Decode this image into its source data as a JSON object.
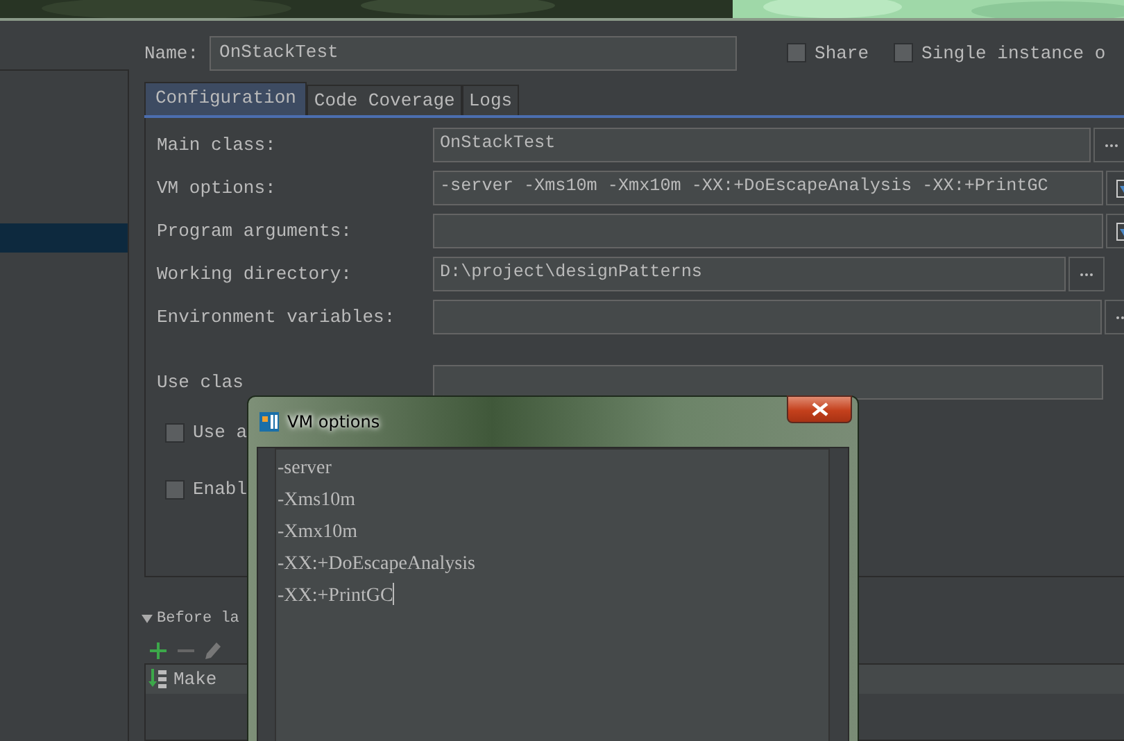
{
  "header": {
    "name_label": "Name:",
    "name_value": "OnStackTest",
    "options": [
      {
        "label": "Share",
        "checked": false
      },
      {
        "label": "Single instance o",
        "checked": false
      }
    ]
  },
  "tabs": [
    {
      "label": "Configuration",
      "selected": true
    },
    {
      "label": "Code Coverage",
      "selected": false
    },
    {
      "label": "Logs",
      "selected": false
    }
  ],
  "fields": [
    {
      "kind": "browse",
      "label": "Main class:",
      "value": "OnStackTest"
    },
    {
      "kind": "expand",
      "label": "VM options:",
      "value": "-server -Xms10m -Xmx10m -XX:+DoEscapeAnalysis -XX:+PrintGC"
    },
    {
      "kind": "expand",
      "label": "Program arguments:"
    },
    {
      "kind": "browse",
      "label": "Working directory:",
      "value": "D:\\project\\designPatterns"
    },
    {
      "kind": "browse",
      "label": "Environment variables:"
    }
  ],
  "classpath": {
    "label": "Use clas"
  },
  "checkboxes": [
    {
      "label": "Use a",
      "checked": false
    },
    {
      "label": "Enabl",
      "checked": false
    }
  ],
  "before_launch": {
    "label": "Before la",
    "expanded": true,
    "tasks": [
      {
        "label": "Make"
      }
    ]
  },
  "dialog": {
    "title": "VM options",
    "lines": [
      "-server",
      "-Xms10m",
      "-Xmx10m",
      "-XX:+DoEscapeAnalysis",
      "-XX:+PrintGC"
    ]
  }
}
